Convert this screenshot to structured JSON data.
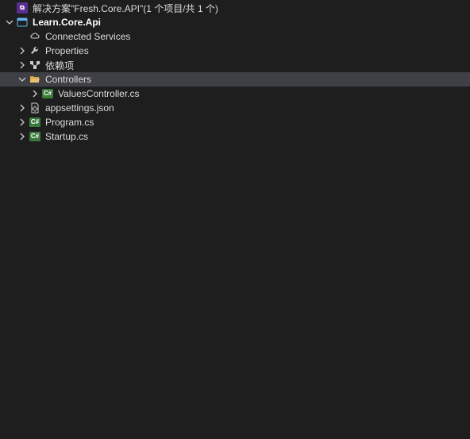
{
  "solution": {
    "label": "解决方案\"Fresh.Core.API\"(1 个项目/共 1 个)"
  },
  "project": {
    "label": "Learn.Core.Api"
  },
  "nodes": {
    "connected_services": "Connected Services",
    "properties": "Properties",
    "dependencies": "依赖项",
    "controllers": "Controllers",
    "values_controller": "ValuesController.cs",
    "appsettings": "appsettings.json",
    "program": "Program.cs",
    "startup": "Startup.cs"
  }
}
